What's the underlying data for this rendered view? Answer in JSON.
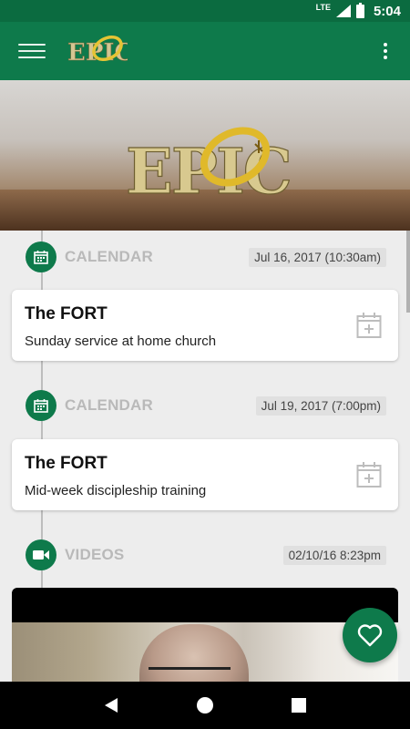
{
  "status_bar": {
    "network": "LTE",
    "time": "5:04"
  },
  "app_bar": {
    "logo_text": "EPIC",
    "accent": "#0e7a4b"
  },
  "hero": {
    "logo_text": "EPIC"
  },
  "feed": [
    {
      "section": "CALENDAR",
      "date": "Jul 16, 2017 (10:30am)",
      "title": "The FORT",
      "subtitle": "Sunday service at home church",
      "icon": "calendar-icon"
    },
    {
      "section": "CALENDAR",
      "date": "Jul 19, 2017 (7:00pm)",
      "title": "The FORT",
      "subtitle": "Mid-week discipleship training",
      "icon": "calendar-icon"
    },
    {
      "section": "VIDEOS",
      "date": "02/10/16 8:23pm",
      "icon": "video-camera-icon"
    }
  ],
  "fab": {
    "icon": "heart-icon"
  },
  "nav": {
    "back_icon": "back-triangle-icon",
    "home_icon": "home-circle-icon",
    "recents_icon": "recents-square-icon"
  }
}
